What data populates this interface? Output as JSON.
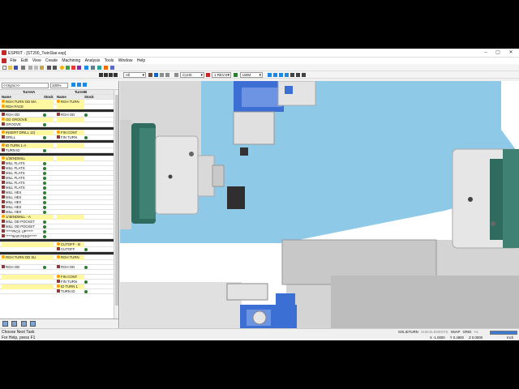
{
  "window": {
    "title": "ESPRIT - [ST200_TwinStar.esp]"
  },
  "menu": [
    "File",
    "Edit",
    "View",
    "Create",
    "Machining",
    "Analysis",
    "Tools",
    "Window",
    "Help"
  ],
  "toolbar": {
    "filter_value": "All",
    "plane_value": "C1H0",
    "work_value": "1 REV.0",
    "view_value": "LWM"
  },
  "panel": {
    "sync_value": "<<Sync>>",
    "zoom_value": "100%",
    "col_turret_a": "TurretA",
    "col_turret_b": "TurretB",
    "col_name": "Name",
    "col_stock": "Stock"
  },
  "operations": [
    {
      "a": "RGH TURN OD MA",
      "b": "RGH TURN",
      "y": true
    },
    {
      "a": "RGH FACE",
      "b": "",
      "y": true
    },
    {
      "a": "",
      "b": "",
      "sep": true
    },
    {
      "a": "RGH OD",
      "b": "RGH OD",
      "y": false
    },
    {
      "a": "OD GROOVE",
      "b": "",
      "y": true
    },
    {
      "a": "GROOVE",
      "b": "",
      "y": false
    },
    {
      "a": "",
      "b": "",
      "sep": true
    },
    {
      "a": "INSERT DRILL 12(",
      "b": "FIN CONT",
      "y": true
    },
    {
      "a": "DRILL",
      "b": "FIN TURN",
      "y": false
    },
    {
      "a": "",
      "b": "",
      "sep": true
    },
    {
      "a": "ID TURN 1-A",
      "b": "",
      "y": true
    },
    {
      "a": "TURN ID",
      "b": "",
      "y": false
    },
    {
      "a": "",
      "b": "",
      "sep": true
    },
    {
      "a": "1/2ENDMILL",
      "b": "",
      "y": true
    },
    {
      "a": "MILL FLATS",
      "b": "",
      "y": false
    },
    {
      "a": "MILL FLATS",
      "b": "",
      "y": false
    },
    {
      "a": "MILL FLATS",
      "b": "",
      "y": false
    },
    {
      "a": "MILL FLATS",
      "b": "",
      "y": false
    },
    {
      "a": "MILL FLATS",
      "b": "",
      "y": false
    },
    {
      "a": "MILL FLATS",
      "b": "",
      "y": false
    },
    {
      "a": "MILL HEX",
      "b": "",
      "y": false
    },
    {
      "a": "MILL HEX",
      "b": "",
      "y": false
    },
    {
      "a": "MILL HEX",
      "b": "",
      "y": false
    },
    {
      "a": "MILL HEX",
      "b": "",
      "y": false
    },
    {
      "a": "MILL HEX",
      "b": "",
      "y": false
    },
    {
      "a": "1/4ENDMILL - A",
      "b": "",
      "y": true
    },
    {
      "a": "MILL OD POCKET",
      "b": "",
      "y": false
    },
    {
      "a": "MILL OD POCKET",
      "b": "",
      "y": false
    },
    {
      "a": "*****PICK UP*****",
      "b": "",
      "y": false
    },
    {
      "a": "*****BAR FEED*****",
      "b": "",
      "y": false
    },
    {
      "a": "",
      "b": "",
      "sep": true
    },
    {
      "a": "",
      "b": "CUTOFF - B",
      "y": true
    },
    {
      "a": "",
      "b": "CUTOFF",
      "y": false
    },
    {
      "a": "",
      "b": "",
      "sep": true
    },
    {
      "a": "RGH TURN OD SU",
      "b": "RGH TURN",
      "y": true
    },
    {
      "a": "",
      "b": "",
      "y": false
    },
    {
      "a": "RGH OD",
      "b": "RGH OD",
      "y": false
    },
    {
      "a": "",
      "b": "",
      "y": false
    },
    {
      "a": "",
      "b": "FIN CONT",
      "y": true
    },
    {
      "a": "",
      "b": "FIN TURN",
      "y": false
    },
    {
      "a": "",
      "b": "ID TURN 1",
      "y": true
    },
    {
      "a": "",
      "b": "TURN ID",
      "y": false
    }
  ],
  "status": {
    "line1": "Choose Next Task",
    "line2": "For Help, press F1",
    "modes": [
      "SOLIDTURN",
      "SUB-ELEMENTS",
      "SNAP",
      "GRID",
      "HL"
    ],
    "x_label": "X -1.0000",
    "y_label": "Y 0.4800",
    "z_label": "Z 0.0000",
    "units": "Inch"
  },
  "colors": {
    "sky": "#8ec9e8",
    "machine_gray": "#d4d4d4",
    "chuck_green": "#2f6b5e",
    "tool_blue": "#3b6fd4"
  }
}
